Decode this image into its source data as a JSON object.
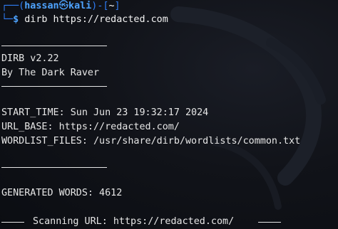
{
  "prompt": {
    "open": "┌──(",
    "user": "hassan",
    "separator": "㉿",
    "host": "kali",
    "close_host": ")-[",
    "cwd": "~",
    "close": "]",
    "corner": "└─",
    "symbol": "$",
    "command": "dirb https://redacted.com"
  },
  "banner": {
    "version": "DIRB v2.22",
    "author": "By The Dark Raver"
  },
  "info": {
    "start_time": "START_TIME: Sun Jun 23 19:32:17 2024",
    "url_base": "URL_BASE: https://redacted.com/",
    "wordlist_files": "WORDLIST_FILES: /usr/share/dirb/wordlists/common.txt"
  },
  "generated_words": "GENERATED WORDS: 4612",
  "scanning": {
    "label": "Scanning URL: https://redacted.com/"
  },
  "icons": {
    "watermark": "kali-dragon-watermark-icon"
  }
}
